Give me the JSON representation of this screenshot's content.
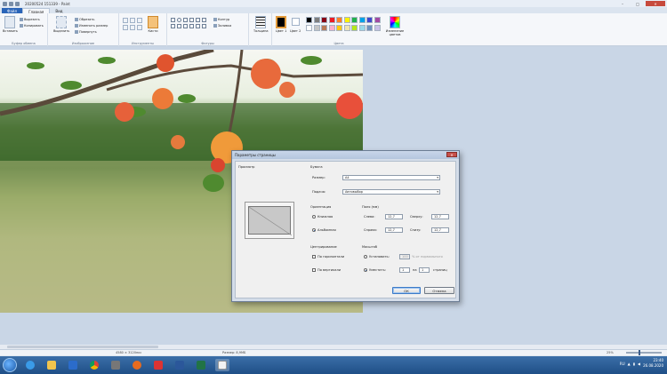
{
  "window": {
    "title": "20200524 151339 - Paint",
    "controls": {
      "minimize": "–",
      "maximize": "□",
      "close": "✕"
    }
  },
  "tabs": {
    "file": "Файл",
    "home": "Главная",
    "view": "Вид"
  },
  "ribbon": {
    "clipboard": {
      "paste": "Вставить",
      "cut": "Вырезать",
      "copy": "Копировать",
      "label": "Буфер обмена"
    },
    "image": {
      "select": "Выделить",
      "crop": "Обрезать",
      "resize": "Изменить размер",
      "rotate": "Повернуть",
      "label": "Изображение"
    },
    "tools": {
      "brushes": "Кисти",
      "label": "Инструменты"
    },
    "shapes": {
      "outline": "Контур",
      "fill": "Заливка",
      "label": "Фигуры"
    },
    "size": {
      "label": "Толщина"
    },
    "colors": {
      "color1": "Цвет 1",
      "color2": "Цвет 2",
      "edit": "Изменение цветов",
      "label": "Цвета"
    }
  },
  "palette": [
    "#000000",
    "#7f7f7f",
    "#880015",
    "#ed1c24",
    "#ff7f27",
    "#fff200",
    "#22b14c",
    "#00a2e8",
    "#3f48cc",
    "#a349a4",
    "#ffffff",
    "#c3c3c3",
    "#b97a57",
    "#ffaec9",
    "#ffc90e",
    "#efe4b0",
    "#b5e61d",
    "#99d9ea",
    "#7092be",
    "#c8bfe7"
  ],
  "status": {
    "dimensions": "4580 × 3120пкс",
    "filesize": "Размер: 8,9МБ",
    "zoom": "25%"
  },
  "dialog": {
    "title": "Параметры страницы",
    "close": "✕",
    "preview_label": "Просмотр",
    "paper_label": "Бумага",
    "size_label": "Размер:",
    "size_value": "A4",
    "source_label": "Подача:",
    "source_value": "Автовыбор",
    "orientation_label": "Ориентация",
    "portrait": "Книжная",
    "landscape": "Альбомная",
    "margins_label": "Поля (мм)",
    "left_label": "Слева:",
    "left_value": "12,7",
    "right_label": "Справа:",
    "right_value": "12,7",
    "top_label": "Сверху:",
    "top_value": "12,7",
    "bottom_label": "Снизу:",
    "bottom_value": "12,7",
    "centering_label": "Центрирование",
    "horizontal": "По горизонтали",
    "vertical": "По вертикали",
    "scale_label": "Масштаб",
    "adjust_label": "Установить:",
    "adjust_value": "100",
    "adjust_suffix": "% от нормального",
    "fit_label": "Уместить:",
    "fit_pages_x": "1",
    "fit_by": "на",
    "fit_pages_y": "1",
    "fit_suffix": "страниц",
    "ok": "ОК",
    "cancel": "Отмена"
  },
  "taskbar": {
    "lang": "RU",
    "time": "23:40",
    "date": "26.08.2020"
  }
}
